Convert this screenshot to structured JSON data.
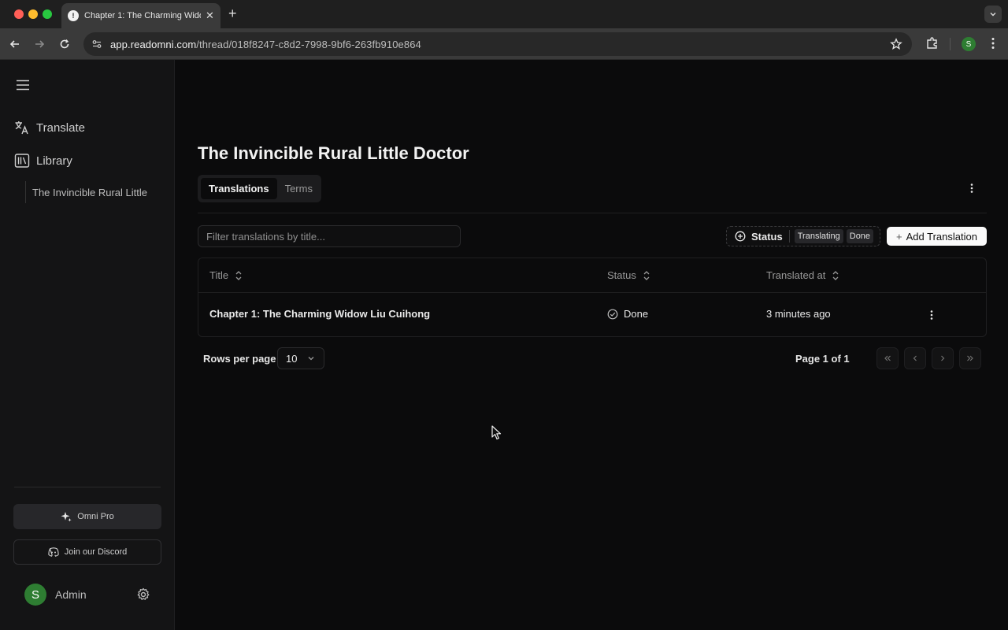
{
  "browser": {
    "tab_title": "Chapter 1: The Charming Widow Liu Cuihong",
    "tab_favicon_letter": "!",
    "url_host": "app.readomni.com",
    "url_path": "/thread/018f8247-c8d2-7998-9bf6-263fb910e864",
    "profile_initial": "S"
  },
  "sidebar": {
    "nav": [
      {
        "label": "Translate",
        "icon": "translate-icon"
      },
      {
        "label": "Library",
        "icon": "library-icon"
      }
    ],
    "library_item": "The Invincible Rural Little",
    "omni_pro_label": "Omni Pro",
    "discord_label": "Join our Discord",
    "user": {
      "initial": "S",
      "name": "Admin"
    }
  },
  "main": {
    "title": "The Invincible Rural Little Doctor",
    "tabs": [
      {
        "label": "Translations",
        "active": true
      },
      {
        "label": "Terms",
        "active": false
      }
    ],
    "filter_placeholder": "Filter translations by title...",
    "status_filter": {
      "label": "Status",
      "chips": [
        "Translating",
        "Done"
      ]
    },
    "add_button": "Add Translation",
    "table": {
      "columns": [
        "Title",
        "Status",
        "Translated at"
      ],
      "rows": [
        {
          "title": "Chapter 1: The Charming Widow Liu Cuihong",
          "status": "Done",
          "translated_at": "3 minutes ago"
        }
      ]
    },
    "pagination": {
      "rows_per_page_label": "Rows per page",
      "rows_per_page_value": "10",
      "page_info": "Page 1 of 1"
    }
  },
  "colors": {
    "background": "#0b0b0c",
    "sidebar": "#141415",
    "accent_button": "#fafafa",
    "avatar": "#2e7d32"
  }
}
